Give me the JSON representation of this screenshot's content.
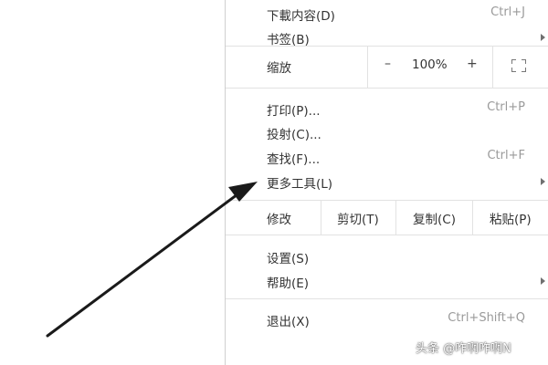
{
  "menu": {
    "downloads": {
      "label": "下載内容(D)",
      "shortcut": "Ctrl+J"
    },
    "bookmarks": {
      "label": "书签(B)"
    },
    "zoom": {
      "label": "缩放",
      "minus": "–",
      "value": "100%",
      "plus": "+"
    },
    "print": {
      "label": "打印(P)...",
      "shortcut": "Ctrl+P"
    },
    "cast": {
      "label": "投射(C)..."
    },
    "find": {
      "label": "查找(F)...",
      "shortcut": "Ctrl+F"
    },
    "more_tools": {
      "label": "更多工具(L)"
    },
    "edit": {
      "label": "修改",
      "cut": "剪切(T)",
      "copy": "复制(C)",
      "paste": "粘贴(P)"
    },
    "settings": {
      "label": "设置(S)"
    },
    "help": {
      "label": "帮助(E)"
    },
    "exit": {
      "label": "退出(X)",
      "shortcut": "Ctrl+Shift+Q"
    }
  },
  "watermark": "头条 @咋啊咋啊N",
  "colors": {
    "arrow": "#1a1a1a",
    "shortcut_text": "#9a9a9a",
    "separator": "#e2e2e2"
  },
  "icons": {
    "fullscreen": "fullscreen-icon",
    "submenu": "chevron-right-icon"
  }
}
